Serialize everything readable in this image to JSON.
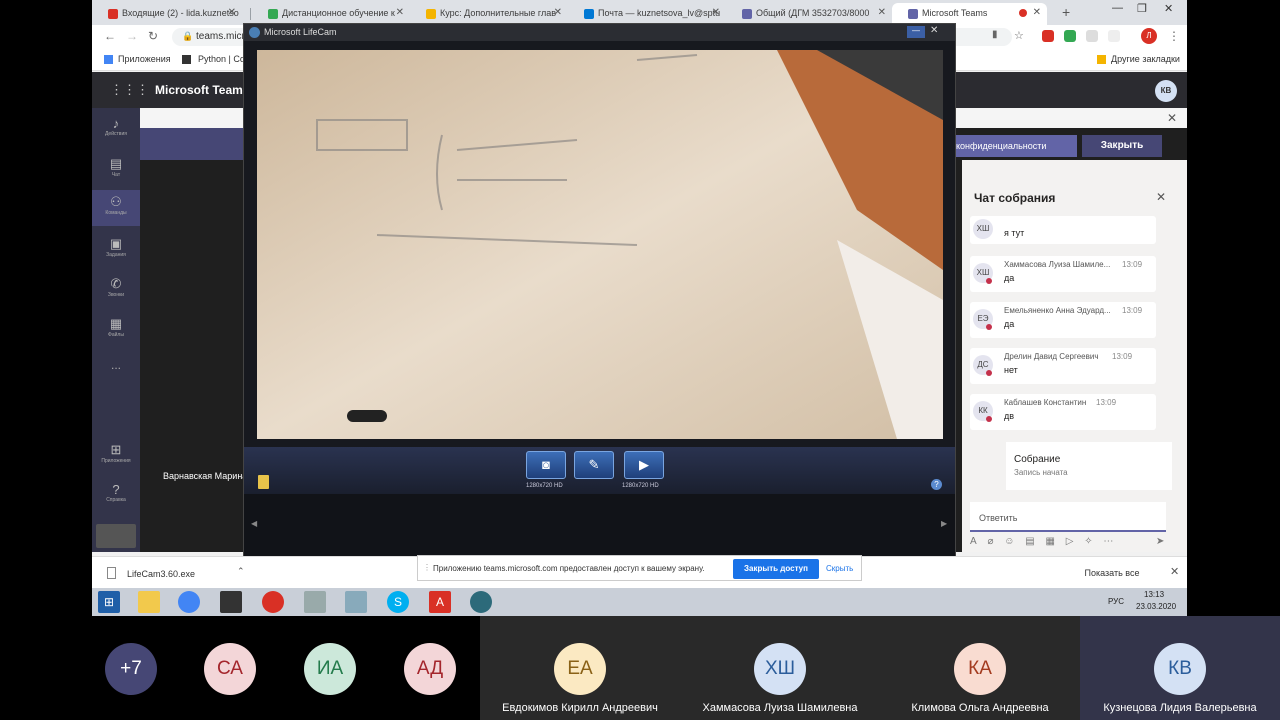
{
  "browser": {
    "tabs": [
      {
        "label": "Входящие (2) - lida.kuznetso",
        "color": "#d93025"
      },
      {
        "label": "Дистанционное обучение к",
        "color": "#34a853"
      },
      {
        "label": "Курс: Дополнительные глав",
        "color": "#f4b400"
      },
      {
        "label": "Почта — kuznetsova_lv@sptu",
        "color": "#0078d4"
      },
      {
        "label": "Общий (ДГМ 3532703/8000",
        "color": "#6264a7"
      },
      {
        "label": "Microsoft Teams",
        "color": "#6264a7"
      }
    ],
    "address": "teams.micr",
    "bookmarks": [
      "Приложения",
      "Python | Co",
      "Другие закладки"
    ],
    "profile_initial": "Л"
  },
  "teams": {
    "app_title": "Microsoft Teams",
    "user_initials": "КВ",
    "rail": [
      "Действия",
      "Чат",
      "Команды",
      "Задания",
      "Звонки",
      "Файлы",
      "...",
      "Приложения",
      "Справка"
    ],
    "privacy_button": "конфиденциальности",
    "close_button": "Закрыть",
    "participant_label": "Варнавская Марина",
    "chat": {
      "title": "Чат собрания",
      "messages": [
        {
          "initials": "ХШ",
          "name": "Хаммасова Луиза Шамиле...",
          "time": "13:09",
          "text": "я тут"
        },
        {
          "initials": "ХШ",
          "name": "Хаммасова Луиза Шамиле...",
          "time": "13:09",
          "text": "да"
        },
        {
          "initials": "ЕЭ",
          "name": "Емельяненко Анна Эдуард...",
          "time": "13:09",
          "text": "да"
        },
        {
          "initials": "ДС",
          "name": "Дрелин Давид Сергеевич",
          "time": "13:09",
          "text": "нет"
        },
        {
          "initials": "КК",
          "name": "Каблашев Константин",
          "time": "13:09",
          "text": "дв"
        }
      ],
      "meeting_title": "Собрание",
      "meeting_subtitle": "Запись начата",
      "reply_placeholder": "Ответить"
    }
  },
  "lifecam": {
    "title": "Microsoft LifeCam",
    "res_photo": "1280x720 HD",
    "res_video": "1280x720 HD"
  },
  "sharing": {
    "text": "Приложению teams.microsoft.com предоставлен доступ к вашему экрану.",
    "stop": "Закрыть доступ",
    "hide": "Скрыть"
  },
  "download": {
    "file": "LifeCam3.60.exe",
    "show_all": "Показать все"
  },
  "taskbar": {
    "lang": "РУС",
    "time": "13:13",
    "date": "23.03.2020"
  },
  "participants": [
    {
      "initials": "+7",
      "name": "",
      "bg": "#464775",
      "fg": "#ffffff"
    },
    {
      "initials": "СА",
      "name": "",
      "bg": "#f3d6d8",
      "fg": "#a4262c"
    },
    {
      "initials": "ИА",
      "name": "",
      "bg": "#cce8da",
      "fg": "#237b4b"
    },
    {
      "initials": "АД",
      "name": "",
      "bg": "#f3d6d8",
      "fg": "#a4262c"
    },
    {
      "initials": "ЕА",
      "name": "Евдокимов Кирилл Андреевич",
      "bg": "#fbe9c2",
      "fg": "#8a6116"
    },
    {
      "initials": "ХШ",
      "name": "Хаммасова Луиза Шамилевна",
      "bg": "#d4e1f4",
      "fg": "#2b5d9b"
    },
    {
      "initials": "КА",
      "name": "Климова Ольга Андреевна",
      "bg": "#f9dcd1",
      "fg": "#a33b1f"
    },
    {
      "initials": "КВ",
      "name": "Кузнецова Лидия Валерьевна",
      "bg": "#d4e1f4",
      "fg": "#2b5d9b"
    }
  ]
}
